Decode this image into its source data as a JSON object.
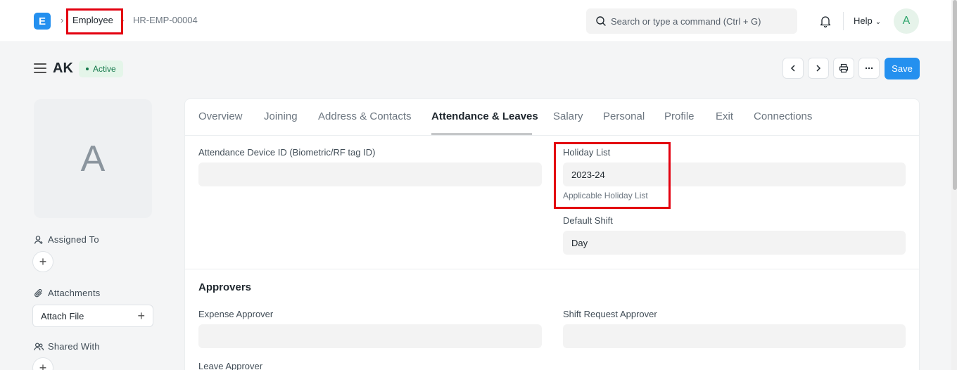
{
  "navbar": {
    "logo_letter": "E",
    "breadcrumbs": [
      "Employee",
      "HR-EMP-00004"
    ],
    "search_placeholder": "Search or type a command (Ctrl + G)",
    "help_label": "Help",
    "user_initial": "A"
  },
  "page_head": {
    "title": "AK",
    "status": "Active",
    "save_label": "Save"
  },
  "sidebar": {
    "avatar_letter": "A",
    "assigned_to_label": "Assigned To",
    "attachments_label": "Attachments",
    "attach_file_label": "Attach File",
    "shared_with_label": "Shared With"
  },
  "tabs": [
    "Overview",
    "Joining",
    "Address & Contacts",
    "Attendance & Leaves",
    "Salary",
    "Personal",
    "Profile",
    "Exit",
    "Connections"
  ],
  "active_tab": "Attendance & Leaves",
  "fields": {
    "attendance_device_id": {
      "label": "Attendance Device ID (Biometric/RF tag ID)",
      "value": ""
    },
    "holiday_list": {
      "label": "Holiday List",
      "value": "2023-24",
      "description": "Applicable Holiday List"
    },
    "default_shift": {
      "label": "Default Shift",
      "value": "Day"
    }
  },
  "approvers": {
    "title": "Approvers",
    "expense_approver": {
      "label": "Expense Approver",
      "value": ""
    },
    "shift_request_approver": {
      "label": "Shift Request Approver",
      "value": ""
    },
    "leave_approver": {
      "label": "Leave Approver"
    }
  },
  "colors": {
    "primary": "#2490ef",
    "annotation": "#e3000f",
    "status_bg": "#e4f5e9",
    "status_text": "#16794c"
  }
}
